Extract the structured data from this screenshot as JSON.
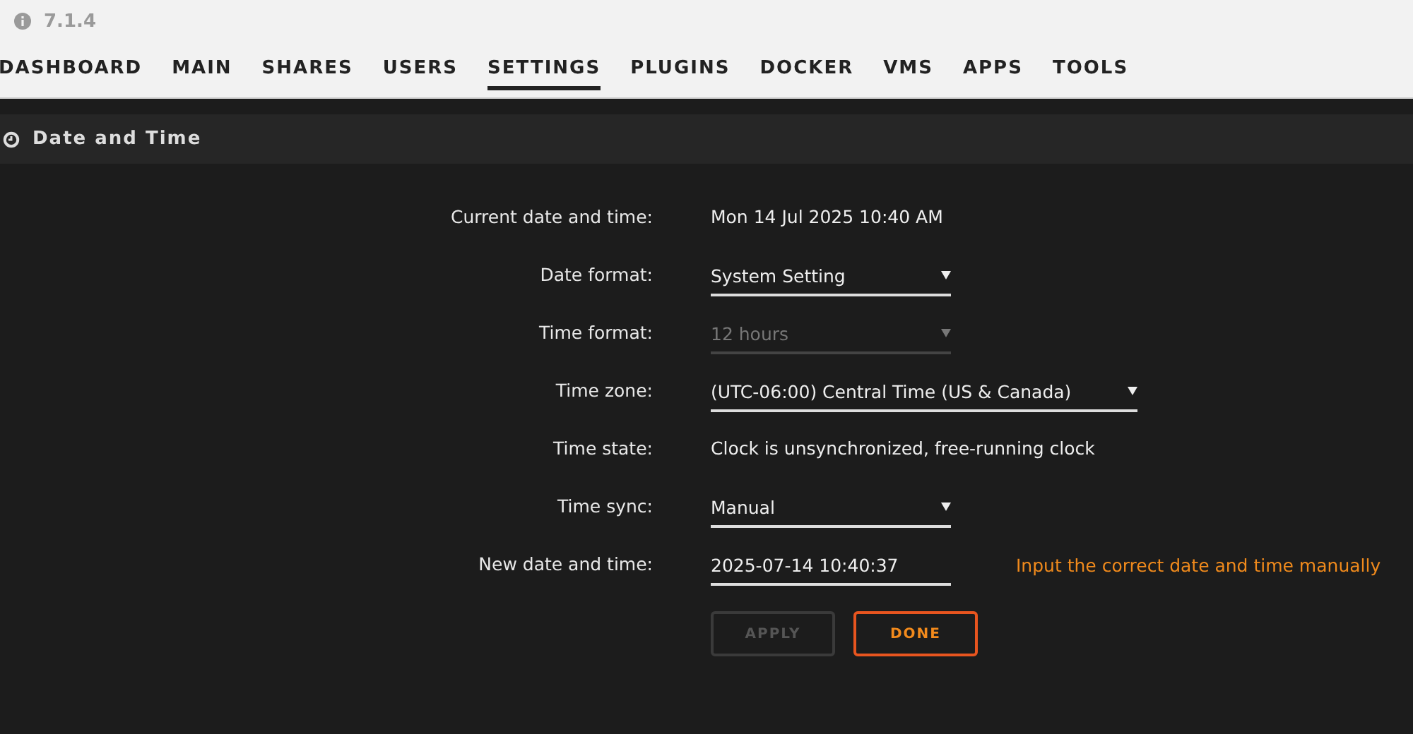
{
  "version": "7.1.4",
  "tabs": [
    {
      "label": "DASHBOARD",
      "selected": false
    },
    {
      "label": "MAIN",
      "selected": false
    },
    {
      "label": "SHARES",
      "selected": false
    },
    {
      "label": "USERS",
      "selected": false
    },
    {
      "label": "SETTINGS",
      "selected": true
    },
    {
      "label": "PLUGINS",
      "selected": false
    },
    {
      "label": "DOCKER",
      "selected": false
    },
    {
      "label": "VMS",
      "selected": false
    },
    {
      "label": "APPS",
      "selected": false
    },
    {
      "label": "TOOLS",
      "selected": false
    }
  ],
  "section": {
    "title": "Date and Time"
  },
  "rows": [
    {
      "kind": "text",
      "label": "Current date and time:",
      "value": "Mon 14 Jul 2025 10:40 AM"
    },
    {
      "kind": "select",
      "label": "Date format:",
      "value": "System Setting",
      "disabled": false
    },
    {
      "kind": "select",
      "label": "Time format:",
      "value": "12 hours",
      "disabled": true
    },
    {
      "kind": "select",
      "label": "Time zone:",
      "value": "(UTC-06:00) Central Time (US & Canada)",
      "disabled": false
    },
    {
      "kind": "text",
      "label": "Time state:",
      "value": "Clock is unsynchronized, free-running clock"
    },
    {
      "kind": "select",
      "label": "Time sync:",
      "value": "Manual",
      "disabled": false
    },
    {
      "kind": "input",
      "label": "New date and time:",
      "value": "2025-07-14 10:40:37",
      "hint": "Input the correct date and time manually"
    }
  ],
  "buttons": [
    {
      "label": "APPLY",
      "disabled": true
    },
    {
      "label": "DONE",
      "disabled": false
    }
  ]
}
